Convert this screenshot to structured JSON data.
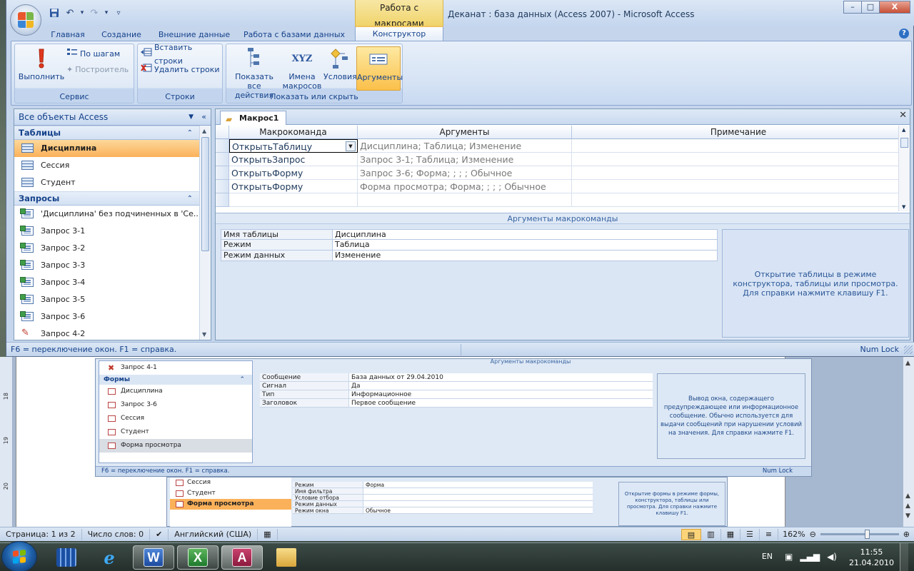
{
  "window": {
    "title": "Деканат : база данных (Access 2007) - Microsoft Access",
    "context_tab_title": "Работа с макросами",
    "controls": {
      "minimize": "–",
      "maximize": "□",
      "close": "X"
    }
  },
  "ribbon": {
    "tabs": [
      "Главная",
      "Создание",
      "Внешние данные",
      "Работа с базами данных",
      "Конструктор"
    ],
    "active_tab": "Конструктор",
    "groups": {
      "service": {
        "label": "Сервис",
        "run": "Выполнить",
        "step": "По шагам",
        "builder": "Построитель"
      },
      "rows": {
        "label": "Строки",
        "insert": "Вставить строки",
        "delete": "Удалить строки"
      },
      "show_hide": {
        "label": "Показать или скрыть",
        "show_all_line1": "Показать",
        "show_all_line2": "все действия",
        "macro_names_line1": "Имена",
        "macro_names_line2": "макросов",
        "conditions": "Условия",
        "arguments": "Аргументы",
        "xyz": "XYZ"
      }
    }
  },
  "nav": {
    "header": "Все объекты Access",
    "categories": [
      {
        "name": "Таблицы",
        "items": [
          "Дисциплина",
          "Сессия",
          "Студент"
        ]
      },
      {
        "name": "Запросы",
        "items": [
          "'Дисциплина' без подчиненных в 'Се...",
          "Запрос 3-1",
          "Запрос 3-2",
          "Запрос 3-3",
          "Запрос 3-4",
          "Запрос 3-5",
          "Запрос 3-6",
          "Запрос 4-2"
        ]
      }
    ],
    "selected_item": "Дисциплина"
  },
  "macro": {
    "tab_title": "Макрос1",
    "columns": [
      "Макрокоманда",
      "Аргументы",
      "Примечание"
    ],
    "rows": [
      {
        "action": "ОткрытьТаблицу",
        "args": "Дисциплина; Таблица; Изменение",
        "note": ""
      },
      {
        "action": "ОткрытьЗапрос",
        "args": "Запрос 3-1; Таблица; Изменение",
        "note": ""
      },
      {
        "action": "ОткрытьФорму",
        "args": "Запрос 3-6; Форма; ; ; ; Обычное",
        "note": ""
      },
      {
        "action": "ОткрытьФорму",
        "args": "Форма просмотра; Форма; ; ; ; Обычное",
        "note": ""
      }
    ],
    "args_title": "Аргументы макрокоманды",
    "args": [
      {
        "key": "Имя таблицы",
        "value": "Дисциплина"
      },
      {
        "key": "Режим",
        "value": "Таблица"
      },
      {
        "key": "Режим данных",
        "value": "Изменение"
      }
    ],
    "help_text": "Открытие таблицы в режиме конструктора, таблицы или просмотра. Для справки нажмите клавишу F1."
  },
  "status": {
    "left": "F6 = переключение окон.  F1 = справка.",
    "right": "Num Lock"
  },
  "word_doc_shot": {
    "nav_top_item": "Запрос 4-1",
    "forms_category": "Формы",
    "forms": [
      "Дисциплина",
      "Запрос 3-6",
      "Сессия",
      "Студент",
      "Форма просмотра"
    ],
    "args_title": "Аргументы макрокоманды",
    "args": [
      {
        "key": "Сообщение",
        "value": "База данных от 29.04.2010"
      },
      {
        "key": "Сигнал",
        "value": "Да"
      },
      {
        "key": "Тип",
        "value": "Информационное"
      },
      {
        "key": "Заголовок",
        "value": "Первое сообщение"
      }
    ],
    "help_text": "Вывод окна, содержащего предупреждающее или информационное сообщение. Обычно используется для выдачи сообщений при нарушении условий на значения. Для справки нажмите F1.",
    "status_left": "F6 = переключение окон.  F1 = справка.",
    "status_right": "Num Lock",
    "ruler_marks": [
      "18",
      "19",
      "20"
    ]
  },
  "word_doc_shot2": {
    "nav_items": [
      "Сессия",
      "Студент",
      "Форма просмотра"
    ],
    "args": [
      {
        "key": "Режим",
        "value": "Форма"
      },
      {
        "key": "Имя фильтра",
        "value": ""
      },
      {
        "key": "Условие отбора",
        "value": ""
      },
      {
        "key": "Режим данных",
        "value": ""
      },
      {
        "key": "Режим окна",
        "value": "Обычное"
      }
    ],
    "help_text": "Открытие формы в режиме формы, конструктора, таблицы или просмотра. Для справки нажмите клавишу F1."
  },
  "word_status": {
    "page": "Страница: 1 из 2",
    "words": "Число слов: 0",
    "language": "Английский (США)",
    "zoom": "162%"
  },
  "taskbar": {
    "lang": "EN",
    "time": "11:55",
    "date": "21.04.2010"
  }
}
